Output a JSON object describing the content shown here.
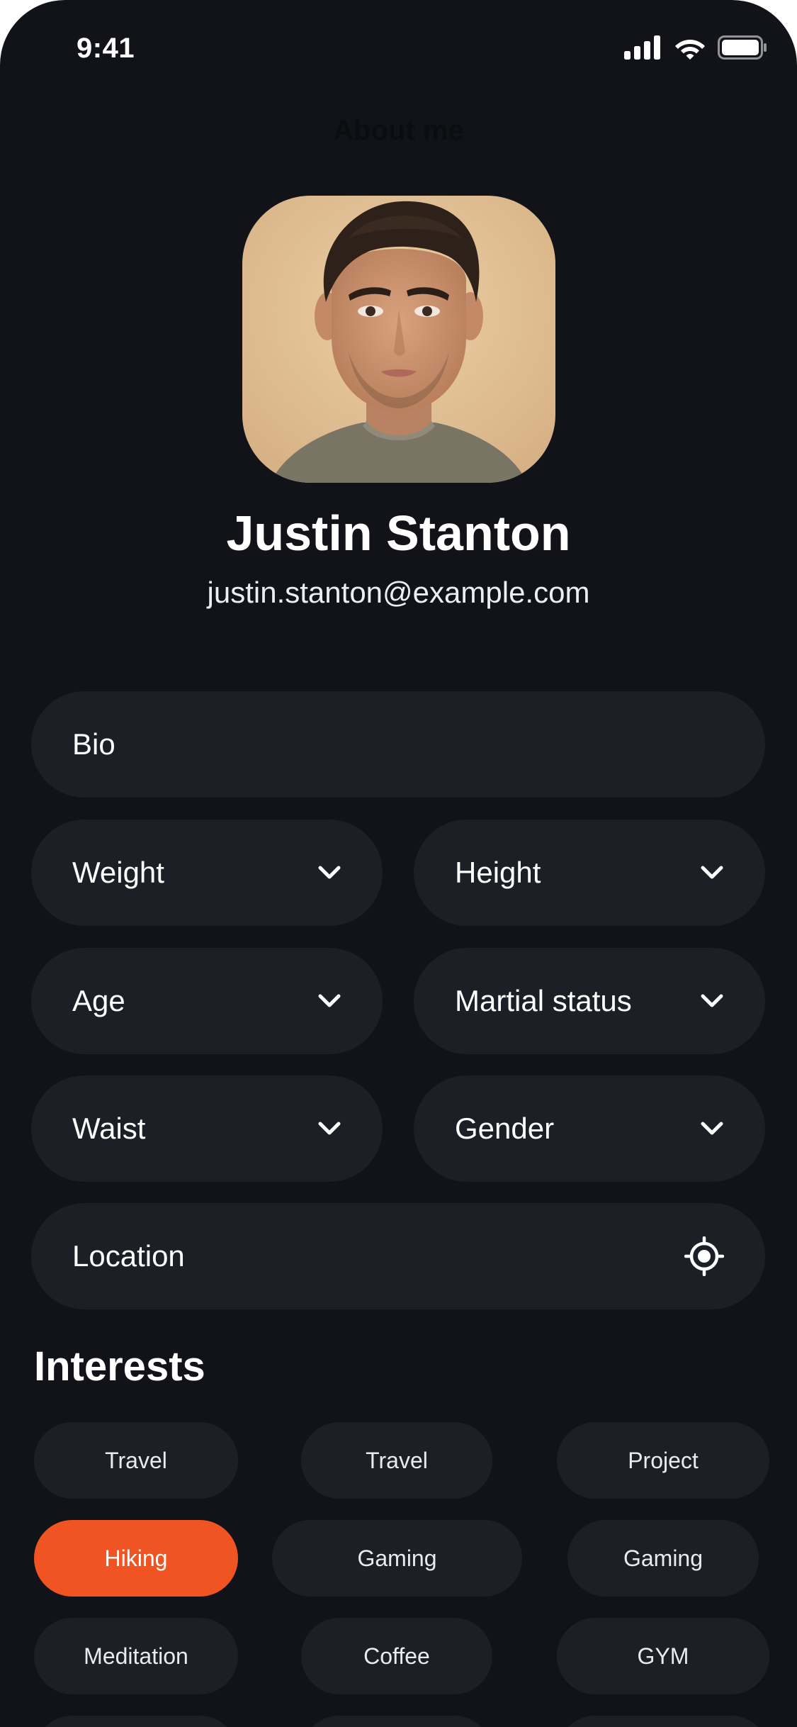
{
  "status_bar": {
    "time": "9:41"
  },
  "header": {
    "title": "About me"
  },
  "profile": {
    "name": "Justin Stanton",
    "email": "justin.stanton@example.com"
  },
  "form": {
    "bio": "Bio",
    "weight": "Weight",
    "height": "Height",
    "age": "Age",
    "marital_status": "Martial status",
    "waist": "Waist",
    "gender": "Gender",
    "location": "Location"
  },
  "interests": {
    "title": "Interests",
    "chips": [
      {
        "label": "Travel",
        "selected": false
      },
      {
        "label": "Travel",
        "selected": false
      },
      {
        "label": "Project",
        "selected": false
      },
      {
        "label": "Hiking",
        "selected": true
      },
      {
        "label": "Gaming",
        "selected": false
      },
      {
        "label": "Gaming",
        "selected": false
      },
      {
        "label": "Meditation",
        "selected": false
      },
      {
        "label": "Coffee",
        "selected": false
      },
      {
        "label": "GYM",
        "selected": false
      }
    ]
  },
  "colors": {
    "background": "#111318",
    "field": "#1c1f25",
    "accent": "#f05423",
    "text": "#ffffff"
  },
  "icons": {
    "status": [
      "cellular-signal-icon",
      "wifi-icon",
      "battery-icon"
    ],
    "dropdown": "chevron-down-icon",
    "location": "crosshair-location-icon"
  }
}
